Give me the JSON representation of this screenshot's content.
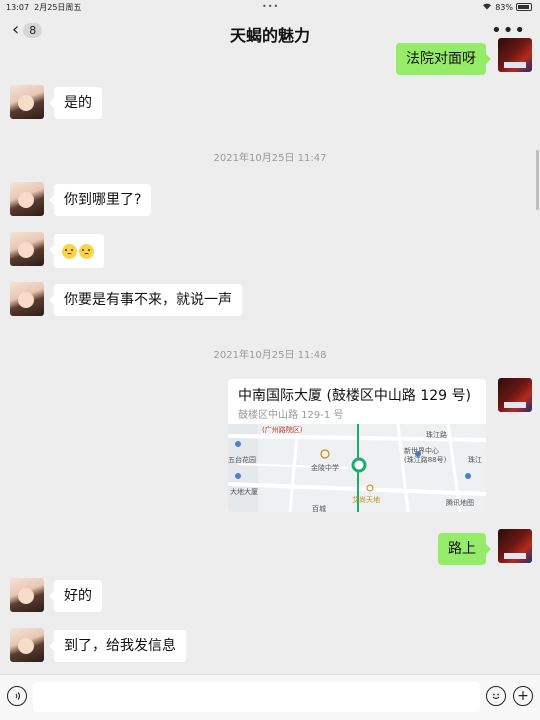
{
  "status_bar": {
    "time": "13:07",
    "date": "2月25日周五",
    "battery": "83%",
    "dots": "•••"
  },
  "nav": {
    "unread_count": "8",
    "title": "天蝎的魅力",
    "back_glyph": "‹",
    "more_glyph": "•••"
  },
  "messages": [
    {
      "side": "out",
      "text": "法院对面呀"
    },
    {
      "side": "in",
      "text": "是的"
    },
    {
      "type": "time",
      "text": "2021年10月25日 11:47"
    },
    {
      "side": "in",
      "text": "你到哪里了?"
    },
    {
      "side": "in",
      "type": "emoji",
      "count": 2
    },
    {
      "side": "in",
      "text": "你要是有事不来，就说一声"
    },
    {
      "type": "time",
      "text": "2021年10月25日 11:48"
    },
    {
      "side": "out",
      "type": "location",
      "title": "中南国际大厦 (鼓楼区中山路 129 号)",
      "address": "鼓楼区中山路 129-1 号",
      "map_labels": [
        "(广州路院区)",
        "五台花园",
        "金陵中学",
        "新世界中心",
        "(珠江路88号)",
        "大地大厦",
        "艾尚天地",
        "珠江",
        "百城",
        "珠江路",
        "腾讯地图"
      ]
    },
    {
      "side": "out",
      "text": "路上"
    },
    {
      "side": "in",
      "text": "好的"
    },
    {
      "side": "in",
      "text": "到了，给我发信息"
    }
  ],
  "input_bar": {
    "placeholder": ""
  },
  "colors": {
    "background": "#ededed",
    "bubble_out": "#95ec69",
    "bubble_in": "#ffffff",
    "map_pin": "#1aad6e"
  },
  "icons": [
    "voice-icon",
    "emoji-icon",
    "plus-icon",
    "more-icon",
    "back-chevron-icon"
  ]
}
